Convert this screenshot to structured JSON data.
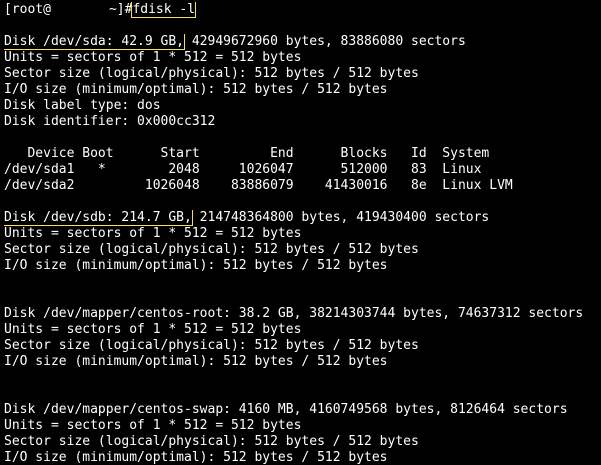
{
  "prompt": {
    "user_host": "[root@",
    "cwd": "~]#",
    "command": "fdisk -l"
  },
  "colors": {
    "background": "#000000",
    "text": "#ffffff",
    "highlight_box": "#f2e15a"
  },
  "sda": {
    "header_boxed": "Disk /dev/sda: 42.9 GB,",
    "header_rest": " 42949672960 bytes, 83886080 sectors",
    "units": "Units = sectors of 1 * 512 = 512 bytes",
    "sector_size": "Sector size (logical/physical): 512 bytes / 512 bytes",
    "io_size": "I/O size (minimum/optimal): 512 bytes / 512 bytes",
    "label_type": "Disk label type: dos",
    "identifier": "Disk identifier: 0x000cc312",
    "table_header": "   Device Boot      Start         End      Blocks   Id  System",
    "rows": [
      "/dev/sda1   *        2048     1026047      512000   83  Linux",
      "/dev/sda2         1026048    83886079    41430016   8e  Linux LVM"
    ]
  },
  "sdb": {
    "header_boxed": "Disk /dev/sdb: 214.7 GB,",
    "header_rest": " 214748364800 bytes, 419430400 sectors",
    "units": "Units = sectors of 1 * 512 = 512 bytes",
    "sector_size": "Sector size (logical/physical): 512 bytes / 512 bytes",
    "io_size": "I/O size (minimum/optimal): 512 bytes / 512 bytes"
  },
  "centos_root": {
    "header": "Disk /dev/mapper/centos-root: 38.2 GB, 38214303744 bytes, 74637312 sectors",
    "units": "Units = sectors of 1 * 512 = 512 bytes",
    "sector_size": "Sector size (logical/physical): 512 bytes / 512 bytes",
    "io_size": "I/O size (minimum/optimal): 512 bytes / 512 bytes"
  },
  "centos_swap": {
    "header": "Disk /dev/mapper/centos-swap: 4160 MB, 4160749568 bytes, 8126464 sectors",
    "units": "Units = sectors of 1 * 512 = 512 bytes",
    "sector_size": "Sector size (logical/physical): 512 bytes / 512 bytes",
    "io_size": "I/O size (minimum/optimal): 512 bytes / 512 bytes"
  }
}
